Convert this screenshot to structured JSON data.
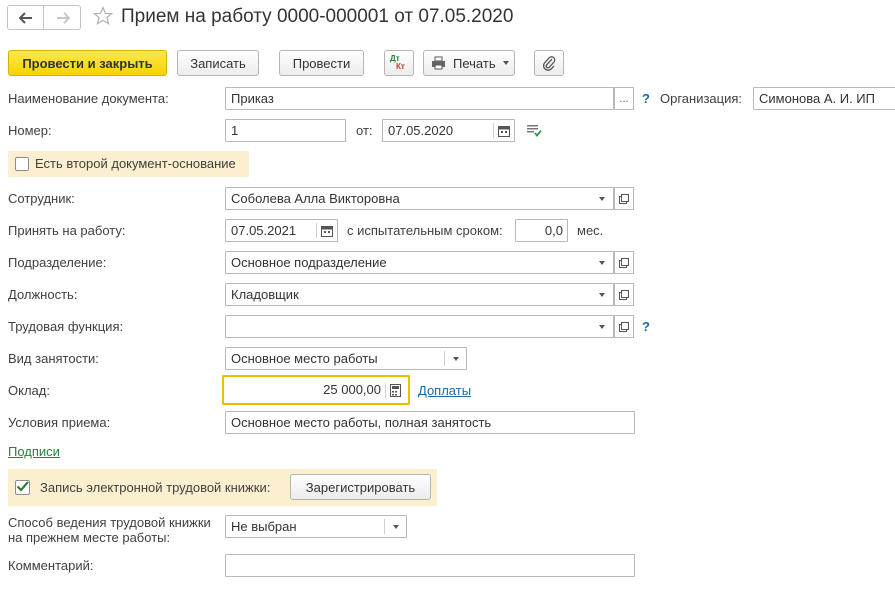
{
  "header": {
    "title": "Прием на работу 0000-000001 от 07.05.2020"
  },
  "toolbar": {
    "post_close": "Провести и закрыть",
    "save": "Записать",
    "post": "Провести",
    "dtkt_top": "Дт",
    "dtkt_bottom": "Кт",
    "print": "Печать"
  },
  "doc_name": {
    "label": "Наименование документа:",
    "value": "Приказ",
    "ellipsis": "...",
    "help": "?"
  },
  "organization": {
    "label": "Организация:",
    "value": "Симонова А. И. ИП"
  },
  "number": {
    "label": "Номер:",
    "value": "1",
    "date_label": "от:",
    "date_value": "07.05.2020"
  },
  "second_doc": {
    "label": "Есть второй документ-основание"
  },
  "employee": {
    "label": "Сотрудник:",
    "value": "Соболева Алла Викторовна"
  },
  "hire": {
    "label": "Принять на работу:",
    "date_value": "07.05.2021",
    "probation_label": "с испытательным сроком:",
    "probation_value": "0,0",
    "unit": "мес."
  },
  "department": {
    "label": "Подразделение:",
    "value": "Основное подразделение"
  },
  "position": {
    "label": "Должность:",
    "value": "Кладовщик"
  },
  "labor_function": {
    "label": "Трудовая функция:",
    "value": "",
    "help": "?"
  },
  "employment_type": {
    "label": "Вид занятости:",
    "value": "Основное место работы"
  },
  "salary": {
    "label": "Оклад:",
    "value": "25 000,00",
    "extra_link": "Доплаты"
  },
  "conditions": {
    "label": "Условия приема:",
    "value": "Основное место работы, полная занятость"
  },
  "signatures_link": "Подписи",
  "e_workbook": {
    "label": "Запись электронной трудовой книжки:",
    "button": "Зарегистрировать",
    "checked": true
  },
  "workbook_method": {
    "label_line1": "Способ ведения трудовой книжки",
    "label_line2": "на прежнем месте работы:",
    "value": "Не выбран"
  },
  "comment": {
    "label": "Комментарий:",
    "value": ""
  },
  "colors": {
    "accent_yellow": "#f5d400",
    "highlight_bg": "#fbefcf",
    "focus_border": "#e8c400",
    "link_blue": "#1a6aa6",
    "link_green": "#2d7f36"
  }
}
